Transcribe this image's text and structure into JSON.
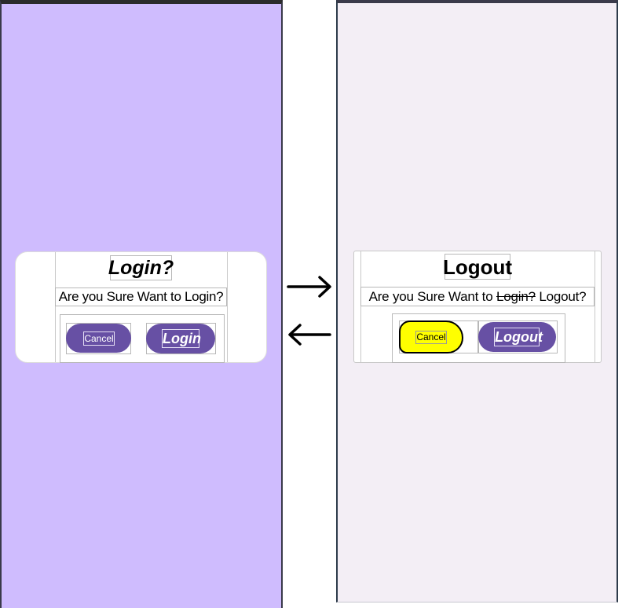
{
  "login_dialog": {
    "title": "Login?",
    "message": "Are you Sure Want to Login?",
    "cancel_label": "Cancel",
    "confirm_label": "Login"
  },
  "logout_dialog": {
    "title": "Logout",
    "message_prefix": "Are you Sure Want to ",
    "message_struck": "Login?",
    "message_suffix": " Logout?",
    "cancel_label": "Cancel",
    "confirm_label": "Logout"
  },
  "colors": {
    "left_background": "#cfbcfe",
    "right_background": "#f3eef5",
    "button_primary": "#6750a4",
    "cancel_highlight": "#ffff00"
  },
  "icons": [
    "arrow-right-icon",
    "arrow-left-icon"
  ]
}
